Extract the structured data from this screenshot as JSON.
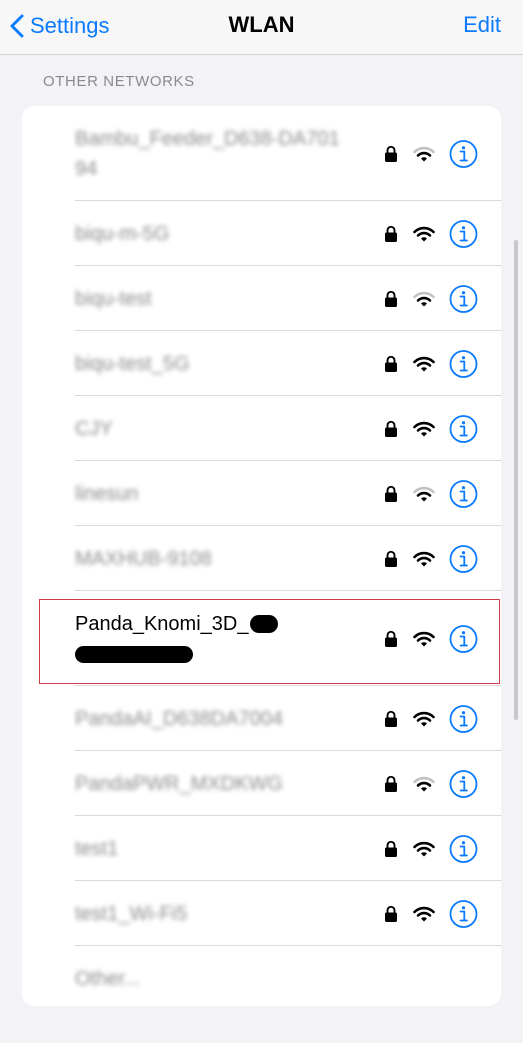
{
  "nav": {
    "back_label": "Settings",
    "title": "WLAN",
    "edit_label": "Edit"
  },
  "section": {
    "header": "OTHER NETWORKS"
  },
  "networks": [
    {
      "name": "Bambu_Feeder_D638-DA70194",
      "locked": true,
      "signal": 2,
      "blurred": true
    },
    {
      "name": "biqu-m-5G",
      "locked": true,
      "signal": 3,
      "blurred": true
    },
    {
      "name": "biqu-test",
      "locked": true,
      "signal": 2,
      "blurred": true
    },
    {
      "name": "biqu-test_5G",
      "locked": true,
      "signal": 3,
      "blurred": true
    },
    {
      "name": "CJY",
      "locked": true,
      "signal": 3,
      "blurred": true
    },
    {
      "name": "linesun",
      "locked": true,
      "signal": 2,
      "blurred": true
    },
    {
      "name": "MAXHUB-9108",
      "locked": true,
      "signal": 3,
      "blurred": true
    },
    {
      "name": "Panda_Knomi_3D_",
      "locked": true,
      "signal": 3,
      "blurred": false,
      "redacted": true,
      "highlighted": true
    },
    {
      "name": "PandaAI_D638DA7004",
      "locked": true,
      "signal": 3,
      "blurred": true
    },
    {
      "name": "PandaPWR_MXDKWG",
      "locked": true,
      "signal": 2,
      "blurred": true
    },
    {
      "name": "test1",
      "locked": true,
      "signal": 3,
      "blurred": true
    },
    {
      "name": "test1_Wi-Fi5",
      "locked": true,
      "signal": 3,
      "blurred": true
    }
  ],
  "other": {
    "label": "Other..."
  },
  "icons": {
    "back": "chevron-left-icon",
    "lock": "lock-icon",
    "wifi": "wifi-icon",
    "info": "info-icon"
  },
  "colors": {
    "accent": "#0a7aff",
    "background": "#f2f2f7",
    "card": "#ffffff",
    "highlight_border": "#d23a4a"
  }
}
